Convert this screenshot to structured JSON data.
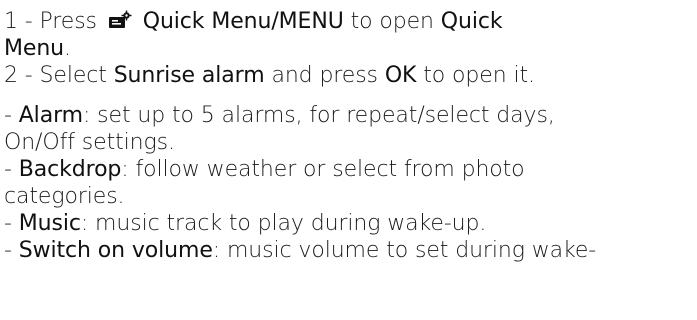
{
  "doc": {
    "step1": {
      "num": "1 -  Press ",
      "icon": "quick-menu-icon",
      "key1": "Quick Menu",
      "sep": "/",
      "key2": "MENU",
      "mid": " to open ",
      "target1": "Quick",
      "target2": "Menu",
      "end": "."
    },
    "step2": {
      "num": "2 -  Select ",
      "key1": "Sunrise alarm",
      "mid": " and press ",
      "key2": "OK",
      "end": " to open it."
    },
    "bullets": {
      "alarm": {
        "dash": "- ",
        "label": "Alarm",
        "text1": ": set up to 5 alarms, for repeat/select days,",
        "text2": "On/Off settings."
      },
      "backdrop": {
        "dash": "- ",
        "label": "Backdrop",
        "text1": ": follow weather or select from photo",
        "text2": "categories."
      },
      "music": {
        "dash": "- ",
        "label": "Music",
        "text1": ": music track to play during wake-up."
      },
      "switch_volume": {
        "dash": "- ",
        "label": "Switch on volume",
        "text1": ": music volume to set during wake-"
      }
    }
  }
}
